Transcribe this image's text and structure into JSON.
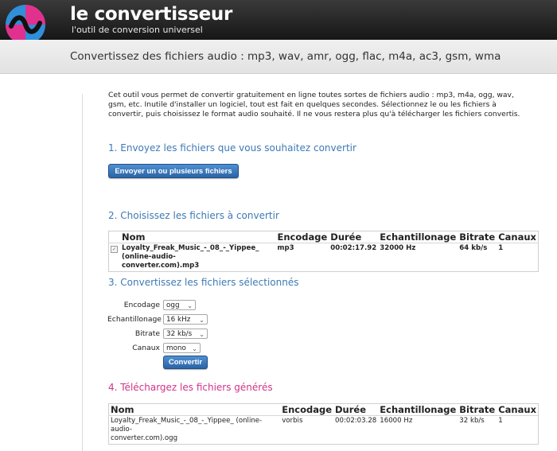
{
  "header": {
    "brand": "le convertisseur",
    "tagline": "l'outil de conversion universel"
  },
  "band": {
    "title": "Convertissez des fichiers audio : mp3, wav, amr, ogg, flac, m4a, ac3, gsm, wma"
  },
  "intro": "Cet outil vous permet de convertir gratuitement en ligne toutes sortes de fichiers audio : mp3, m4a, ogg, wav, gsm, etc. Inutile d'installer un logiciel, tout est fait en quelques secondes. Sélectionnez le ou les fichiers à convertir, puis choisissez le format audio souhaité. Il ne vous restera plus qu'à télécharger les fichiers convertis.",
  "steps": {
    "s1": "1. Envoyez les fichiers que vous souhaitez convertir",
    "s2": "2. Choisissez les fichiers à convertir",
    "s3": "3. Convertissez les fichiers sélectionnés",
    "s4": "4. Téléchargez les fichiers générés"
  },
  "upload_button": "Envoyer un ou plusieurs fichiers",
  "columns": [
    "Nom",
    "Encodage",
    "Durée",
    "Echantillonage",
    "Bitrate",
    "Canaux"
  ],
  "input_files": [
    {
      "name_line1": "Loyalty_Freak_Music_-_08_-_Yippee_ (online-audio-",
      "name_line2": "converter.com).mp3",
      "encodage": "mp3",
      "duree": "00:02:17.92",
      "echantillonage": "32000 Hz",
      "bitrate": "64 kb/s",
      "canaux": "1",
      "checked": true
    }
  ],
  "form": {
    "encodage_label": "Encodage",
    "encodage_value": "ogg",
    "echantillonage_label": "Echantillonage",
    "echantillonage_value": "16 kHz",
    "bitrate_label": "Bitrate",
    "bitrate_value": "32 kb/s",
    "canaux_label": "Canaux",
    "canaux_value": "mono",
    "convert_button": "Convertir"
  },
  "output_files": [
    {
      "name_line1": "Loyalty_Freak_Music_-_08_-_Yippee_ (online-audio-",
      "name_line2": "converter.com).ogg",
      "encodage": "vorbis",
      "duree": "00:02:03.28",
      "echantillonage": "16000 Hz",
      "bitrate": "32 kb/s",
      "canaux": "1"
    }
  ],
  "colors": {
    "step_blue": "#3d7ab6",
    "step_pink": "#d1338a",
    "button_blue": "#2a64a6",
    "logo_blue": "#2f8fd8",
    "logo_pink": "#e0318f"
  }
}
